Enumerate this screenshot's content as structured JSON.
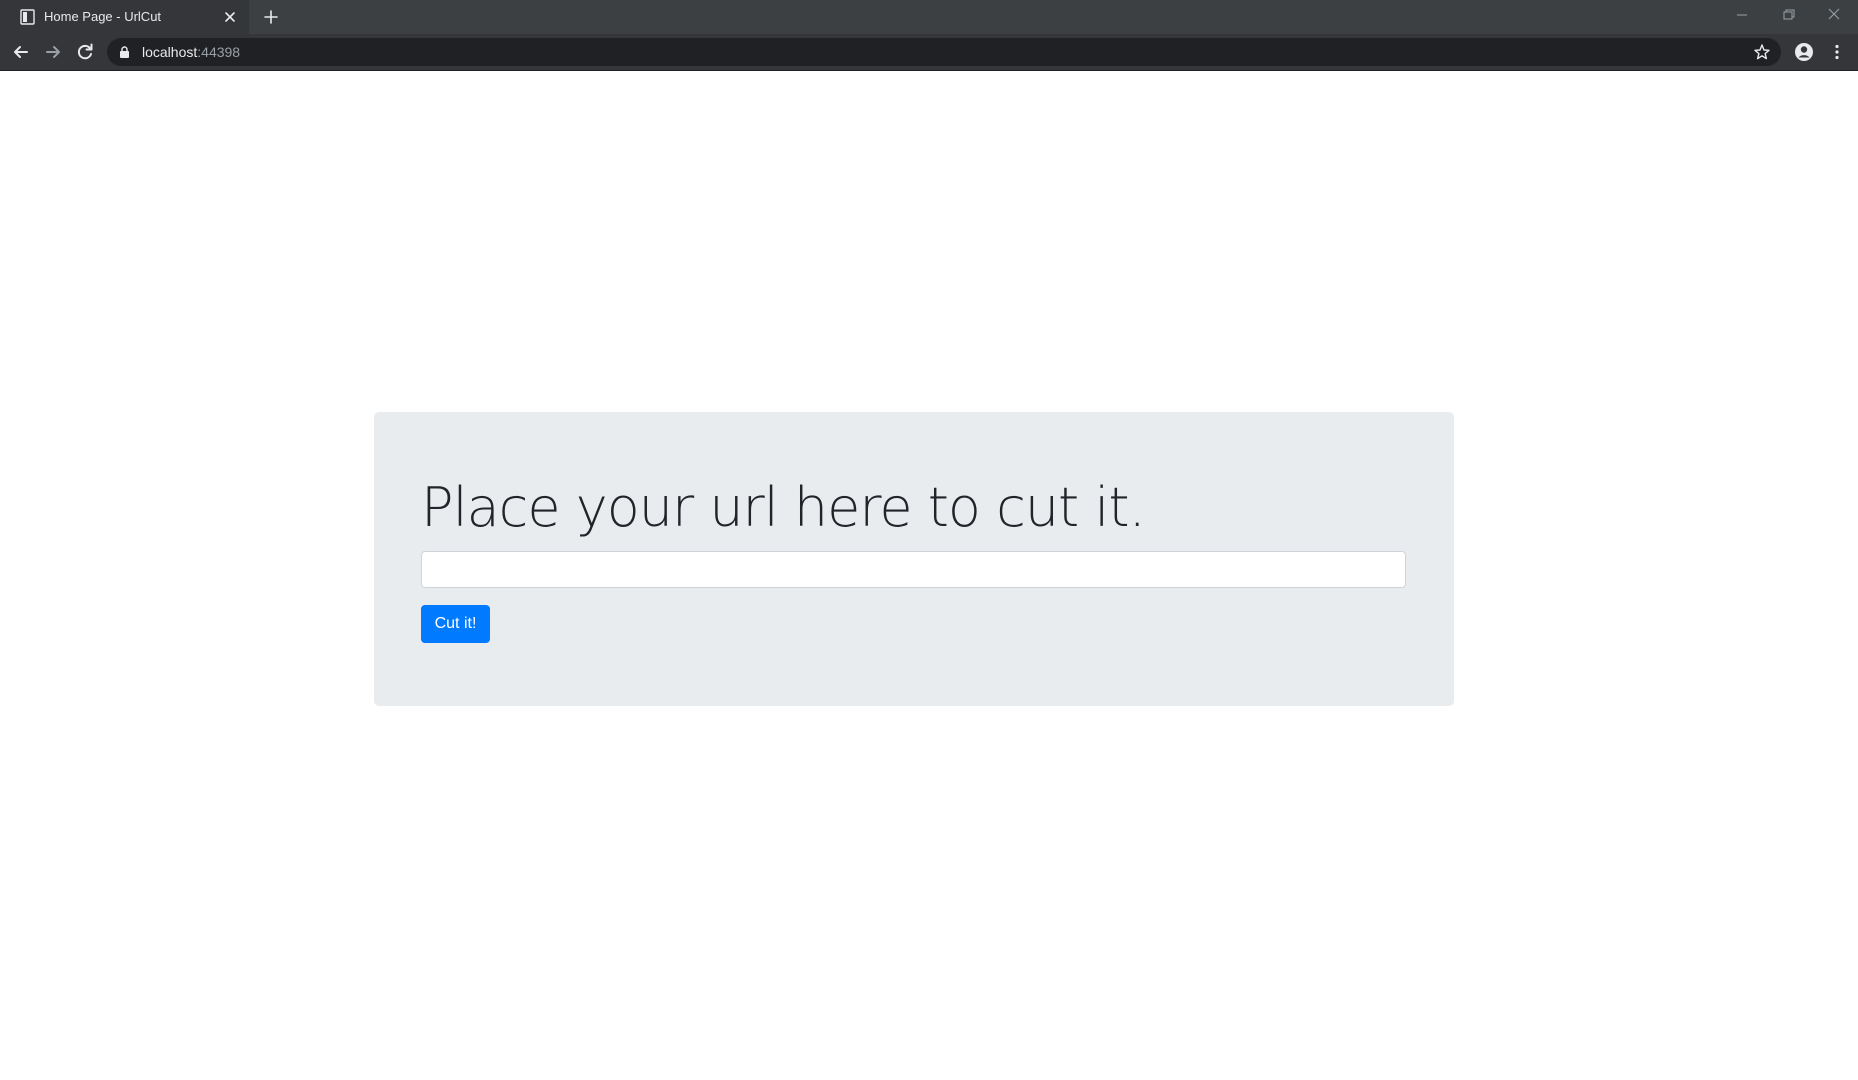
{
  "browser": {
    "tab": {
      "title": "Home Page - UrlCut"
    },
    "address_bar": {
      "host": "localhost",
      "port": ":44398"
    },
    "icons": {
      "favicon": "page-icon",
      "tab_close": "close-icon",
      "new_tab": "plus-icon",
      "back": "arrow-left-icon",
      "forward": "arrow-right-icon",
      "reload": "reload-icon",
      "lock": "lock-icon",
      "bookmark": "star-icon",
      "profile": "account-circle-icon",
      "menu": "more-vertical-icon",
      "minimize": "minimize-icon",
      "restore": "restore-icon",
      "close_window": "close-icon"
    }
  },
  "page": {
    "heading": "Place your url here to cut it.",
    "url_input": {
      "value": "",
      "placeholder": ""
    },
    "submit_label": "Cut it!"
  },
  "colors": {
    "primary": "#007bff",
    "jumbotron_bg": "#e9ecef",
    "heading_text": "#212529",
    "chrome_dark": "#35363a",
    "omnibox_bg": "#202124"
  }
}
